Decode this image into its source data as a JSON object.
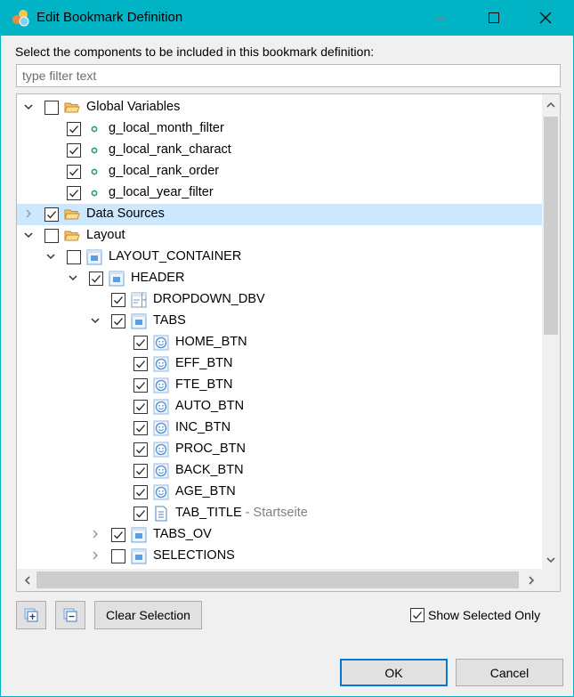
{
  "window": {
    "title": "Edit Bookmark Definition",
    "accent_color": "#00b4c6"
  },
  "instruction": "Select the components to be included in this bookmark definition:",
  "filter": {
    "placeholder": "type filter text",
    "value": ""
  },
  "tree": {
    "items": [
      {
        "label": "Global Variables",
        "level": 0,
        "expander": "expanded",
        "checked": false,
        "icon": "folder-icon",
        "selected": false
      },
      {
        "label": "g_local_month_filter",
        "level": 1,
        "expander": "none",
        "checked": true,
        "icon": "variable-icon",
        "selected": false
      },
      {
        "label": "g_local_rank_charact",
        "level": 1,
        "expander": "none",
        "checked": true,
        "icon": "variable-icon",
        "selected": false
      },
      {
        "label": "g_local_rank_order",
        "level": 1,
        "expander": "none",
        "checked": true,
        "icon": "variable-icon",
        "selected": false
      },
      {
        "label": "g_local_year_filter",
        "level": 1,
        "expander": "none",
        "checked": true,
        "icon": "variable-icon",
        "selected": false
      },
      {
        "label": "Data Sources",
        "level": 0,
        "expander": "collapsed",
        "checked": true,
        "icon": "folder-icon",
        "selected": true
      },
      {
        "label": "Layout",
        "level": 0,
        "expander": "expanded",
        "checked": false,
        "icon": "folder-icon",
        "selected": false
      },
      {
        "label": "LAYOUT_CONTAINER",
        "level": 1,
        "expander": "expanded",
        "checked": false,
        "icon": "panel-icon",
        "selected": false
      },
      {
        "label": "HEADER",
        "level": 2,
        "expander": "expanded",
        "checked": true,
        "icon": "panel-icon",
        "selected": false
      },
      {
        "label": "DROPDOWN_DBV",
        "level": 3,
        "expander": "none",
        "checked": true,
        "icon": "dropdown-icon",
        "selected": false
      },
      {
        "label": "TABS",
        "level": 3,
        "expander": "expanded",
        "checked": true,
        "icon": "panel-icon",
        "selected": false
      },
      {
        "label": "HOME_BTN",
        "level": 4,
        "expander": "none",
        "checked": true,
        "icon": "button-icon",
        "selected": false
      },
      {
        "label": "EFF_BTN",
        "level": 4,
        "expander": "none",
        "checked": true,
        "icon": "button-icon",
        "selected": false
      },
      {
        "label": "FTE_BTN",
        "level": 4,
        "expander": "none",
        "checked": true,
        "icon": "button-icon",
        "selected": false
      },
      {
        "label": "AUTO_BTN",
        "level": 4,
        "expander": "none",
        "checked": true,
        "icon": "button-icon",
        "selected": false
      },
      {
        "label": "INC_BTN",
        "level": 4,
        "expander": "none",
        "checked": true,
        "icon": "button-icon",
        "selected": false
      },
      {
        "label": "PROC_BTN",
        "level": 4,
        "expander": "none",
        "checked": true,
        "icon": "button-icon",
        "selected": false
      },
      {
        "label": "BACK_BTN",
        "level": 4,
        "expander": "none",
        "checked": true,
        "icon": "button-icon",
        "selected": false
      },
      {
        "label": "AGE_BTN",
        "level": 4,
        "expander": "none",
        "checked": true,
        "icon": "button-icon",
        "selected": false
      },
      {
        "label": "TAB_TITLE",
        "suffix": " - Startseite",
        "level": 4,
        "expander": "none",
        "checked": true,
        "icon": "text-icon",
        "selected": false
      },
      {
        "label": "TABS_OV",
        "level": 3,
        "expander": "collapsed",
        "checked": true,
        "icon": "panel-icon",
        "selected": false
      },
      {
        "label": "SELECTIONS",
        "level": 3,
        "expander": "collapsed",
        "checked": false,
        "icon": "panel-icon",
        "selected": false
      },
      {
        "label": "",
        "level": 3,
        "expander": "none",
        "checked": false,
        "icon": "panel-icon",
        "selected": false,
        "partial": true
      }
    ]
  },
  "toolbar": {
    "expand_all_icon": "expand-all-icon",
    "collapse_all_icon": "collapse-all-icon",
    "clear_selection_label": "Clear Selection",
    "show_selected_only_label": "Show Selected Only",
    "show_selected_only_checked": true
  },
  "buttons": {
    "ok_label": "OK",
    "cancel_label": "Cancel"
  }
}
